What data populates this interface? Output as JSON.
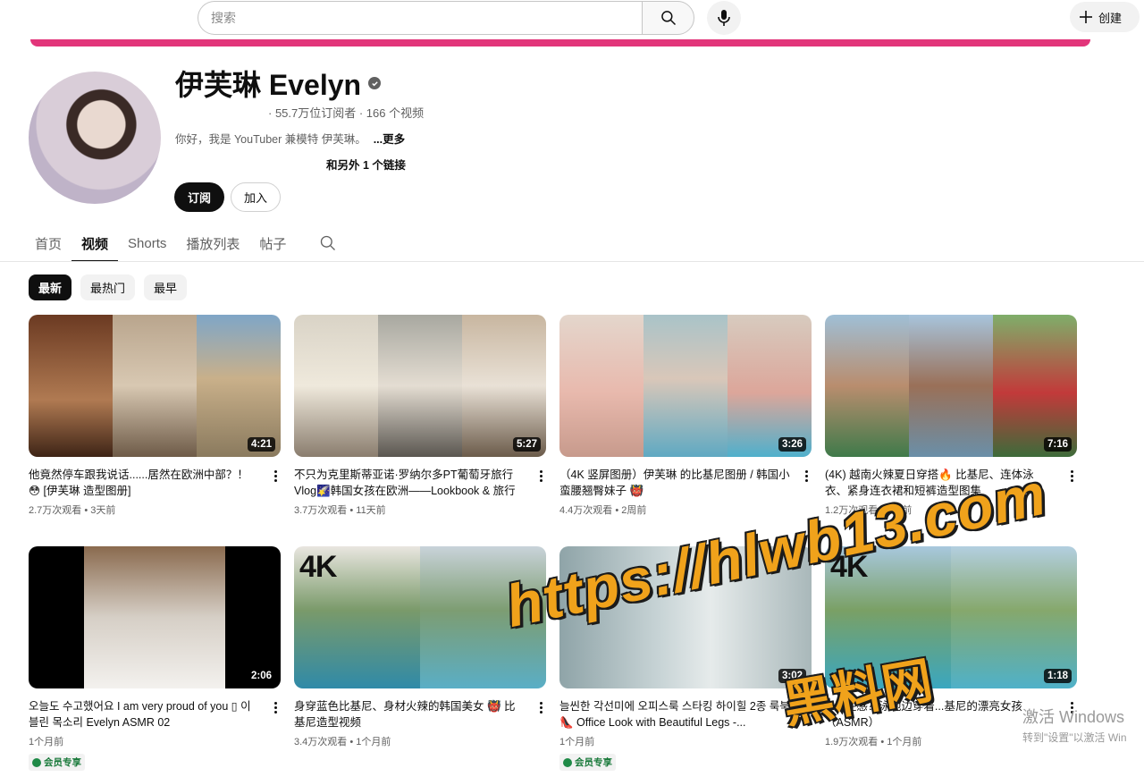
{
  "search": {
    "placeholder": "搜索"
  },
  "header": {
    "create_label": "创建"
  },
  "channel": {
    "name": "伊芙琳 Evelyn",
    "stats": "· 55.7万位订阅者 · 166 个视频",
    "description": "你好，我是 YouTuber 兼模特 伊芙琳。",
    "more_label": "...更多",
    "links_label": "和另外 1 个链接",
    "subscribe_label": "订阅",
    "join_label": "加入"
  },
  "tabs": [
    {
      "label": "首页"
    },
    {
      "label": "视频"
    },
    {
      "label": "Shorts"
    },
    {
      "label": "播放列表"
    },
    {
      "label": "帖子"
    }
  ],
  "chips": [
    {
      "label": "最新"
    },
    {
      "label": "最热门"
    },
    {
      "label": "最早"
    }
  ],
  "videos": [
    {
      "title": "他竟然停车跟我说话......居然在欧洲中部？！😳 [伊芙琳 造型图册]",
      "duration": "4:21",
      "views": "2.7万次观看",
      "age": "3天前"
    },
    {
      "title": "不只为克里斯蒂亚诺·罗纳尔多PT葡萄牙旅行Vlog🌠韩国女孩在欧洲——Lookbook & 旅行",
      "duration": "5:27",
      "views": "3.7万次观看",
      "age": "11天前"
    },
    {
      "title": "（4K 竖屏图册）伊芙琳 的比基尼图册 / 韩国小蛮腰翘臀妹子 👹",
      "duration": "3:26",
      "views": "4.4万次观看",
      "age": "2周前"
    },
    {
      "title": "(4K) 越南火辣夏日穿搭🔥 比基尼、连体泳衣、紧身连衣裙和短裤造型图集",
      "duration": "7:16",
      "views": "1.2万次观看",
      "age": "3周前"
    },
    {
      "title": "오늘도 수고했어요 I am very proud of you ▯ 이블린 목소리 Evelyn ASMR 02",
      "duration": "2:06",
      "views": "",
      "age": "1个月前",
      "member": "会员专享"
    },
    {
      "title": "身穿蓝色比基尼、身材火辣的韩国美女 👹 比基尼造型视频",
      "duration": "",
      "views": "3.4万次观看",
      "age": "1个月前"
    },
    {
      "title": "늘씬한 각선미에 오피스룩 스타킹 하이힐 2종 룩북 👠 Office Look with Beautiful Legs -...",
      "duration": "3:02",
      "views": "",
      "age": "1个月前",
      "member": "会员专享"
    },
    {
      "title": "...是性感？泳池边穿着...基尼的漂亮女孩（ASMR）",
      "duration": "1:18",
      "views": "1.9万次观看",
      "age": "1个月前"
    }
  ],
  "watermark": {
    "url": "https://hlwb13.com",
    "cn": "黑料网"
  },
  "windows": {
    "line1": "激活 Windows",
    "line2": "转到\"设置\"以激活 Win"
  },
  "colors": {
    "accent_banner": "#e2357a",
    "watermark": "#f0a21b",
    "member_green": "#1f8a47"
  }
}
